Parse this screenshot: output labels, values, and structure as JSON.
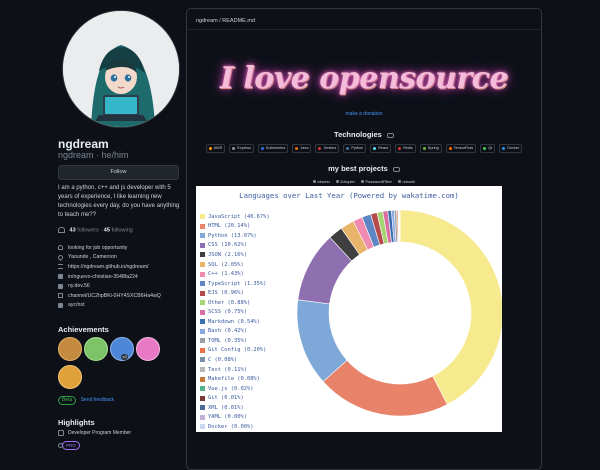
{
  "profile": {
    "name": "ngdream",
    "handle": "ngdream · he/him",
    "follow_label": "Follow",
    "bio": "I am a python, c++ and js developer with 5 years of experience, I like learning new technologies every day, do you have anything to teach me??",
    "followers_count": "43",
    "followers_label": "followers",
    "following_count": "45",
    "following_label": "following",
    "details": [
      {
        "icon": "person-icon",
        "text": "looking for job opportunity"
      },
      {
        "icon": "location-pin-icon",
        "text": "Yaounde , Cameroon"
      },
      {
        "icon": "link-icon",
        "text": "https://ngdream.github.io/ngdream/"
      },
      {
        "icon": "linkedin-icon",
        "text": "in/nguevo-christian-3548fa224"
      },
      {
        "icon": "facebook-icon",
        "text": "ny.dev.56"
      },
      {
        "icon": "email-icon",
        "text": "channel/UC2hpBKi-0HY4SXCB6Ha4wQ"
      },
      {
        "icon": "linkedin-icon",
        "text": "ayc/nst"
      }
    ],
    "achievements_title": "Achievements",
    "achievement_badges": [
      {
        "name": "pull-shark-badge",
        "color": "#c48a3f",
        "count": ""
      },
      {
        "name": "quickdraw-badge",
        "color": "#7cc36a",
        "count": ""
      },
      {
        "name": "yolo-badge",
        "color": "#4e86d8",
        "count": "x2"
      },
      {
        "name": "pair-extraordinaire-badge",
        "color": "#e879c5",
        "count": ""
      },
      {
        "name": "starstruck-badge",
        "color": "#e0a03a",
        "count": ""
      }
    ],
    "beta_pill": "Beta",
    "beta_link": "Send feedback",
    "highlights_title": "Highlights",
    "highlight_item": "Developer Program Member",
    "pro_pill": "PRO"
  },
  "readme": {
    "path": "ngdream / README.md",
    "banner_text": "I love opensource",
    "donation_link": "make a donation",
    "technologies_title": "Technologies",
    "technologies": [
      {
        "label": "AWS",
        "color": "#ff9900"
      },
      {
        "label": "Express",
        "color": "#8b949e"
      },
      {
        "label": "Kubernetes",
        "color": "#326ce5"
      },
      {
        "label": "Java",
        "color": "#e76f00"
      },
      {
        "label": "Jenkins",
        "color": "#d33833"
      },
      {
        "label": "Python",
        "color": "#3776ab"
      },
      {
        "label": "React",
        "color": "#61dafb"
      },
      {
        "label": "Redis",
        "color": "#dc382d"
      },
      {
        "label": "Spring",
        "color": "#6db33f"
      },
      {
        "label": "TensorFlow",
        "color": "#ff6f00"
      },
      {
        "label": "Qt",
        "color": "#41cd52"
      },
      {
        "label": "Docker",
        "color": "#2496ed"
      }
    ],
    "projects_title": "my best projects",
    "projects": [
      "ekwesi",
      "Zdrupier",
      "PasswordFilter",
      "ndowhi"
    ]
  },
  "chart_data": {
    "type": "pie",
    "title": "Languages over Last Year (Powered by wakatime.com)",
    "categories": [
      "JavaScript",
      "HTML",
      "Python",
      "CSS",
      "JSON",
      "SQL",
      "C++",
      "TypeScript",
      "EJS",
      "Other",
      "SCSS",
      "Markdown",
      "Bash",
      "TOML",
      "Git Config",
      "C",
      "Text",
      "Makefile",
      "Vue.js",
      "Git",
      "XML",
      "YAML",
      "Docker"
    ],
    "values": [
      40.67,
      20.14,
      13.07,
      10.62,
      2.16,
      2.05,
      1.43,
      1.35,
      0.96,
      0.88,
      0.75,
      0.54,
      0.42,
      0.35,
      0.2,
      0.08,
      0.11,
      0.08,
      0.02,
      0.01,
      0.01,
      0.0,
      0.0
    ],
    "labels": [
      "JavaScript (40.67%)",
      "HTML (20.14%)",
      "Python (13.07%)",
      "CSS (10.62%)",
      "JSON (2.16%)",
      "SQL (2.05%)",
      "C++ (1.43%)",
      "TypeScript (1.35%)",
      "EJS (0.96%)",
      "Other (0.88%)",
      "SCSS (0.75%)",
      "Markdown (0.54%)",
      "Bash (0.42%)",
      "TOML (0.35%)",
      "Git Config (0.20%)",
      "C (0.08%)",
      "Text (0.11%)",
      "Makefile (0.08%)",
      "Vue.js (0.02%)",
      "Git (0.01%)",
      "XML (0.01%)",
      "YAML (0.00%)",
      "Docker (0.00%)"
    ],
    "colors": [
      "#f7e98e",
      "#e8836a",
      "#7ea8d8",
      "#8e6fb0",
      "#3f3f3f",
      "#e8b46a",
      "#f08ab0",
      "#5e85c4",
      "#b64a4a",
      "#a7d472",
      "#d96fa0",
      "#3a6fb0",
      "#8aa8e0",
      "#9aa0a6",
      "#e86f4a",
      "#7c8fa8",
      "#b8b8b8",
      "#c47a3a",
      "#4fb08a",
      "#7a3a3a",
      "#4a6a9a",
      "#c0b0d8",
      "#c8d8f0"
    ],
    "legend": "left"
  }
}
